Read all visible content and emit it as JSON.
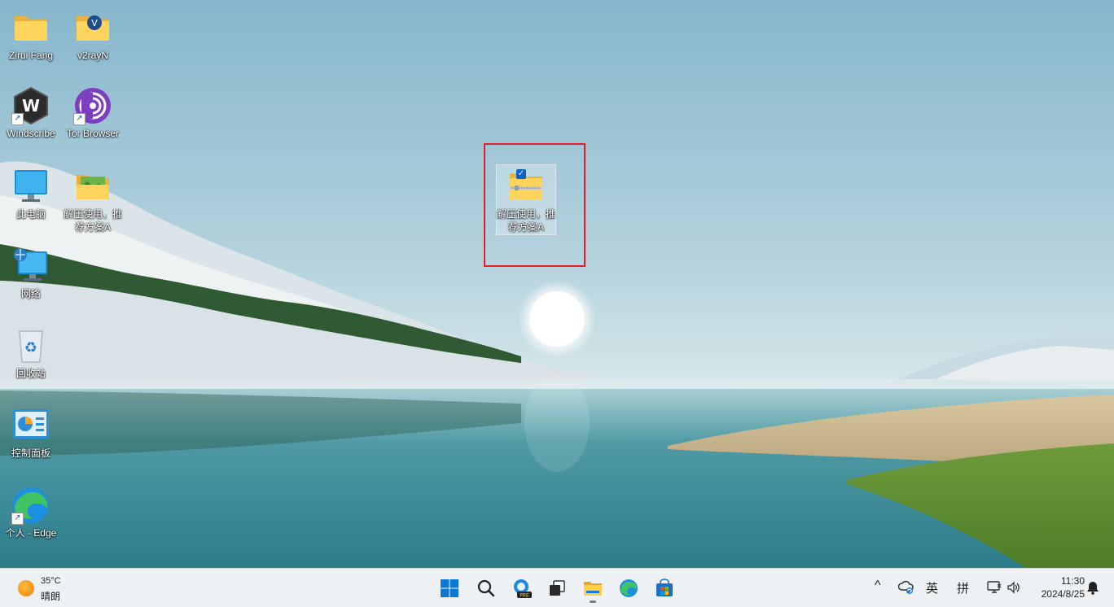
{
  "desktop": {
    "icons": [
      {
        "label": "Zirui Fang",
        "icon": "folder-icon"
      },
      {
        "label": "v2rayN",
        "icon": "v2rayn-folder-icon"
      },
      {
        "label": "Windscribe",
        "icon": "windscribe-icon"
      },
      {
        "label": "Tor Browser",
        "icon": "tor-browser-icon"
      },
      {
        "label": "此电脑",
        "icon": "computer-icon"
      },
      {
        "label": "解压使用，推荐方案A",
        "icon": "image-folder-icon"
      },
      {
        "label": "网络",
        "icon": "network-icon"
      },
      {
        "label": "回收站",
        "icon": "recycle-bin-icon"
      },
      {
        "label": "控制面板",
        "icon": "control-panel-icon"
      },
      {
        "label": "个人 - Edge",
        "icon": "edge-icon"
      }
    ],
    "selected_item": {
      "label_line1": "解压使用，推",
      "label_line2": "荐方案A",
      "icon": "zip-folder-icon",
      "checked": true
    }
  },
  "taskbar": {
    "weather": {
      "temp": "35°C",
      "condition": "晴朗",
      "icon": "sun-icon"
    },
    "pinned": [
      {
        "name": "start-button",
        "icon": "windows-logo-icon"
      },
      {
        "name": "search-button",
        "icon": "search-icon"
      },
      {
        "name": "copilot-button",
        "icon": "copilot-pre-icon"
      },
      {
        "name": "task-view-button",
        "icon": "task-view-icon"
      },
      {
        "name": "file-explorer-button",
        "icon": "file-explorer-icon",
        "active": true
      },
      {
        "name": "edge-button",
        "icon": "edge-icon"
      },
      {
        "name": "store-button",
        "icon": "store-icon"
      }
    ],
    "tray": {
      "chevron": "^",
      "ime_lang": "英",
      "ime_mode": "拼",
      "time": "11:30",
      "date": "2024/8/25"
    }
  },
  "colors": {
    "accent": "#0b5fc6",
    "highlight_box": "#e01e2a",
    "taskbar_bg": "#eef1f4"
  }
}
